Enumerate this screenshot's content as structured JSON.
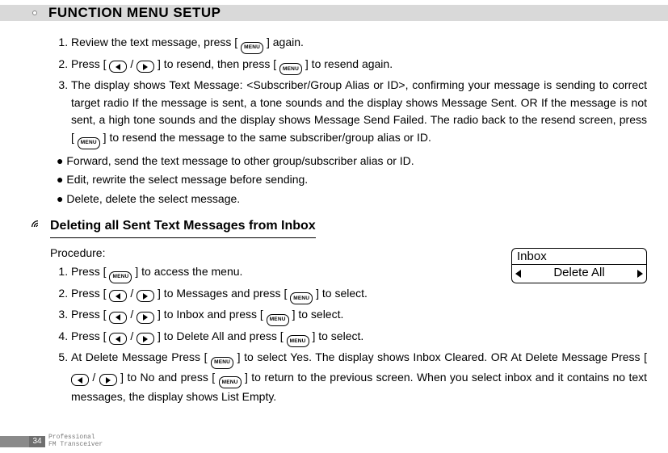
{
  "header": {
    "title": "FUNCTION MENU SETUP"
  },
  "intro_list": {
    "i1_a": "Review the text message, press [ ",
    "i1_b": " ] again.",
    "i2_a": "Press [ ",
    "i2_b": " / ",
    "i2_c": " ] to resend, then press [ ",
    "i2_d": " ] to resend again.",
    "i3_a": "The display shows Text Message: <Subscriber/Group Alias or ID>, confirming your message is sending to correct target radio If the message is sent, a tone sounds and the display shows Message Sent. OR If the message is not sent, a high tone sounds and the display shows Message Send Failed. The radio back to the resend screen, press [ ",
    "i3_b": " ] to resend the message to the same subscriber/group alias or ID."
  },
  "bullets": {
    "b1": "Forward, send the text message to other group/subscriber alias or ID.",
    "b2": "Edit, rewrite the select message before sending.",
    "b3": "Delete, delete the select message."
  },
  "sub": {
    "title": "Deleting all Sent Text Messages from Inbox",
    "procedure_label": "Procedure:"
  },
  "proc": {
    "p1_a": "Press [ ",
    "p1_b": " ] to access the menu.",
    "p2_a": "Press [ ",
    "p2_b": " / ",
    "p2_c": " ] to Messages and press [ ",
    "p2_d": " ] to select.",
    "p3_a": "Press [ ",
    "p3_b": " / ",
    "p3_c": " ] to Inbox and press [ ",
    "p3_d": " ] to select.",
    "p4_a": "Press [ ",
    "p4_b": " / ",
    "p4_c": " ] to Delete All and press [ ",
    "p4_d": " ] to select.",
    "p5_a": "At Delete Message Press [ ",
    "p5_b": " ] to select Yes. The display shows Inbox Cleared. OR At Delete Message Press [ ",
    "p5_c": " / ",
    "p5_d": " ] to No and press [ ",
    "p5_e": " ] to return to the previous screen. When you select inbox and it contains no text messages, the display shows List Empty."
  },
  "screen": {
    "row1": "Inbox",
    "row2": "Delete All"
  },
  "key": {
    "menu_label": "MENU"
  },
  "footer": {
    "page": "34",
    "line1": "Professional",
    "line2": "FM Transceiver"
  }
}
